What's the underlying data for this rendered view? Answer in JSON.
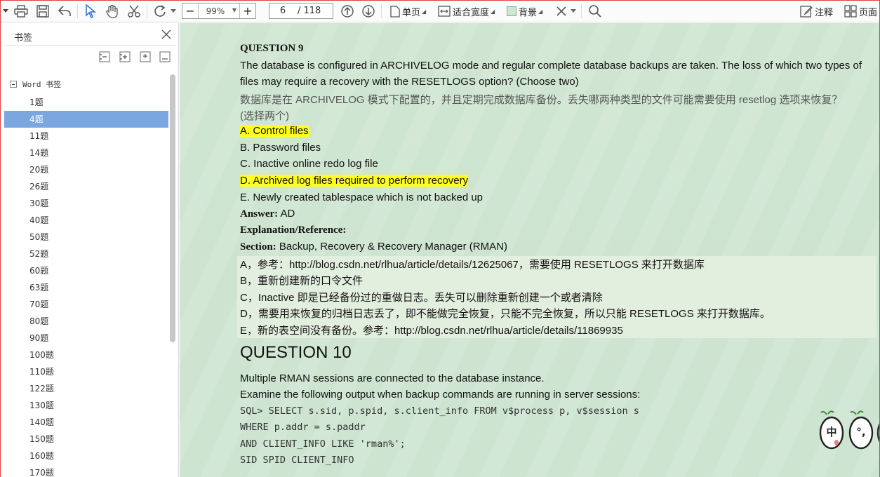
{
  "toolbar": {
    "zoom": "99%",
    "page_current": "6",
    "page_total": "/ 118",
    "single_page": "单页",
    "fit_width": "适合宽度",
    "background": "背景",
    "annotate": "注释",
    "page": "页面"
  },
  "sidebar": {
    "title": "书签",
    "root_label": "Word 书签",
    "items": [
      "1题",
      "4题",
      "11题",
      "14题",
      "20题",
      "26题",
      "30题",
      "40题",
      "50题",
      "52题",
      "60题",
      "63题",
      "70题",
      "80题",
      "90题",
      "100题",
      "110题",
      "122题",
      "130题",
      "140题",
      "150题",
      "160题",
      "170题"
    ],
    "selected_index": 1
  },
  "doc": {
    "q9_title": "QUESTION 9",
    "q9_line1": "The database is configured in ARCHIVELOG mode and regular complete database backups are taken. The loss of which two types of",
    "q9_line2": "files may require a recovery with the RESETLOGS option? (Choose two)",
    "q9_cn1": "数据库是在 ARCHIVELOG 模式下配置的，并且定期完成数据库备份。丢失哪两种类型的文件可能需要使用 resetlog 选项来恢复？",
    "q9_cn2": "(选择两个)",
    "opt_a": "A. Control files",
    "opt_b": "B. Password files",
    "opt_c": "C. Inactive online redo log file",
    "opt_d": "D. Archived log files required to perform recovery",
    "opt_e": "E. Newly created tablespace which is not backed up",
    "answer_label": "Answer:",
    "answer_value": "AD",
    "explanation": "Explanation/Reference:",
    "section_label": "Section:",
    "section_value": "Backup, Recovery & Recovery Manager (RMAN)",
    "note_a": "A，参考：http://blog.csdn.net/rlhua/article/details/12625067，需要使用 RESETLOGS 来打开数据库",
    "note_b": "B，重新创建新的口令文件",
    "note_c": "C，Inactive 即是已经备份过的重做日志。丢失可以删除重新创建一个或者清除",
    "note_d": "D，需要用来恢复的归档日志丢了，即不能做完全恢复，只能不完全恢复，所以只能 RESETLOGS 来打开数据库。",
    "note_e": "E，新的表空间没有备份。参考：http://blog.csdn.net/rlhua/article/details/11869935",
    "q10_title": "QUESTION 10",
    "q10_line1": "Multiple RMAN sessions are connected to the database instance.",
    "q10_line2": "Examine the following output when backup commands are running in server sessions:",
    "sql1": "SQL> SELECT s.sid, p.spid, s.client_info FROM v$process p, v$session s",
    "sql2": "WHERE p.addr = s.paddr",
    "sql3": "AND CLIENT_INFO LIKE 'rman%';",
    "sql4": "SID SPID CLIENT_INFO",
    "mascot1": "中",
    "mascot2": "°,"
  }
}
